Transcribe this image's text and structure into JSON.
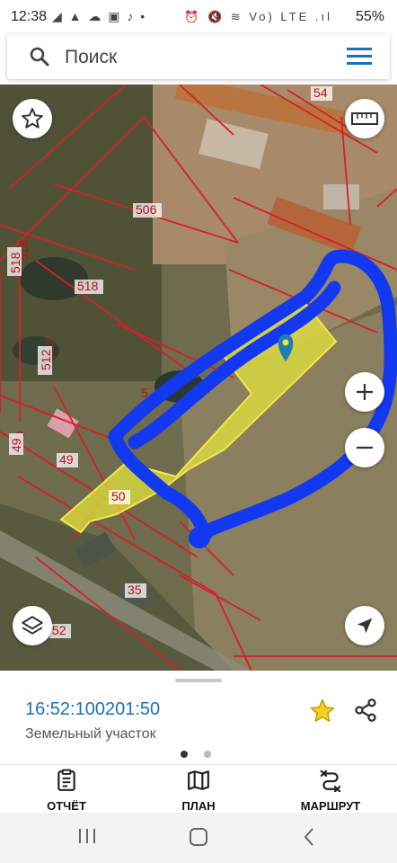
{
  "status_bar": {
    "time": "12:38",
    "left_icons": "◢ ▲ ☁ ▣ ♪ •",
    "right_icons": "⏰ 🔇 ≋ Vo) LTE .ıl",
    "battery": "55%"
  },
  "search": {
    "placeholder": "Поиск"
  },
  "map": {
    "parcel_labels": [
      "54",
      "506",
      "518",
      "518",
      "512",
      "5",
      "49",
      "49",
      "50",
      "35",
      "52"
    ],
    "colors": {
      "boundary": "#d81e2a",
      "selected_fill": "#e8e83a",
      "drawn_outline": "#1238f0",
      "marker": "#1e7fb5"
    }
  },
  "parcel": {
    "cadastral_number": "16:52:100201:50",
    "kind": "Земельный участок"
  },
  "toolbar": {
    "items": [
      {
        "label": "ОТЧЁТ",
        "icon": "report-icon"
      },
      {
        "label": "ПЛАН",
        "icon": "map-plan-icon"
      },
      {
        "label": "МАРШРУТ",
        "icon": "route-icon"
      }
    ]
  }
}
